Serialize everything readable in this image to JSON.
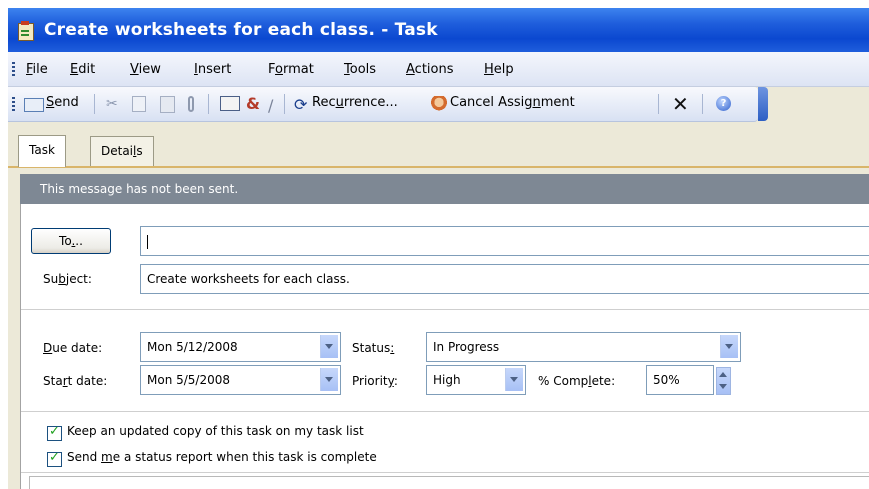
{
  "window": {
    "title": "Create worksheets for each class. - Task"
  },
  "menu": {
    "file": "File",
    "edit": "Edit",
    "view": "View",
    "insert": "Insert",
    "format": "Format",
    "tools": "Tools",
    "actions": "Actions",
    "help": "Help"
  },
  "toolbar": {
    "send": "Send",
    "recurrence": "Recurrence...",
    "cancel_assignment": "Cancel Assignment"
  },
  "tabs": {
    "task": "Task",
    "details": "Details"
  },
  "infobar": {
    "message": "This message has not been sent."
  },
  "form": {
    "to_button": "To...",
    "to_value": "",
    "subject_label": "Subject:",
    "subject_value": "Create worksheets for each class.",
    "due_date_label": "Due date:",
    "due_date_value": "Mon 5/12/2008",
    "start_date_label": "Start date:",
    "start_date_value": "Mon 5/5/2008",
    "status_label": "Status:",
    "status_value": "In Progress",
    "priority_label": "Priority:",
    "priority_value": "High",
    "complete_label": "% Complete:",
    "complete_value": "50%",
    "keep_copy_label": "Keep an updated copy of this task on my task list",
    "status_report_label": "Send me a status report when this task is complete"
  },
  "colors": {
    "titlebar": "#0B48D0",
    "infobar": "#7E8894",
    "tab_accent": "#D9B56A"
  }
}
